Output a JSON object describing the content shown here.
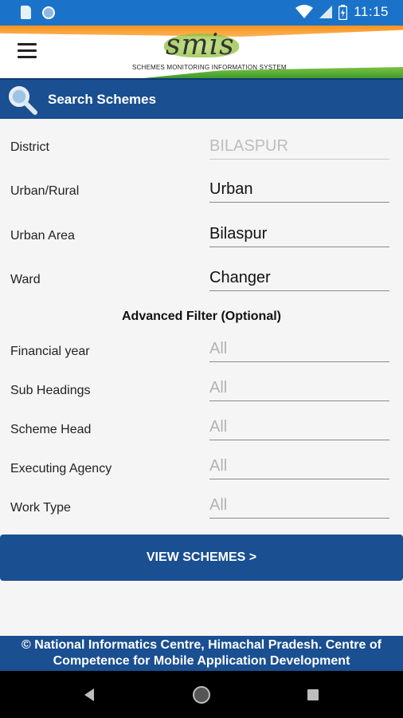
{
  "status_bar": {
    "time": "11:15",
    "icons": [
      "sd-card-icon",
      "circle-icon",
      "wifi-icon",
      "signal-icon",
      "battery-icon"
    ]
  },
  "app_bar": {
    "logo_text": "smis",
    "logo_subtitle": "SCHEMES MONITORING INFORMATION SYSTEM"
  },
  "search_header": {
    "title": "Search Schemes"
  },
  "fields": [
    {
      "label": "District",
      "value": "BILASPUR"
    },
    {
      "label": "Urban/Rural",
      "value": "Urban"
    },
    {
      "label": "Urban Area",
      "value": "Bilaspur"
    },
    {
      "label": "Ward",
      "value": "Changer"
    }
  ],
  "advanced_filter": {
    "title": "Advanced Filter (Optional)",
    "fields": [
      {
        "label": "Financial year",
        "value": "All"
      },
      {
        "label": "Sub Headings",
        "value": "All"
      },
      {
        "label": "Scheme Head",
        "value": "All"
      },
      {
        "label": "Executing Agency",
        "value": "All"
      },
      {
        "label": "Work Type",
        "value": "All"
      }
    ]
  },
  "view_button": {
    "label": "VIEW SCHEMES >"
  },
  "footer": {
    "line1": "© National Informatics Centre, Himachal Pradesh. Centre of",
    "line2": "Competence for Mobile Application Development"
  },
  "colors": {
    "primary": "#1a4f91",
    "status_bar": "#1a73c9"
  }
}
